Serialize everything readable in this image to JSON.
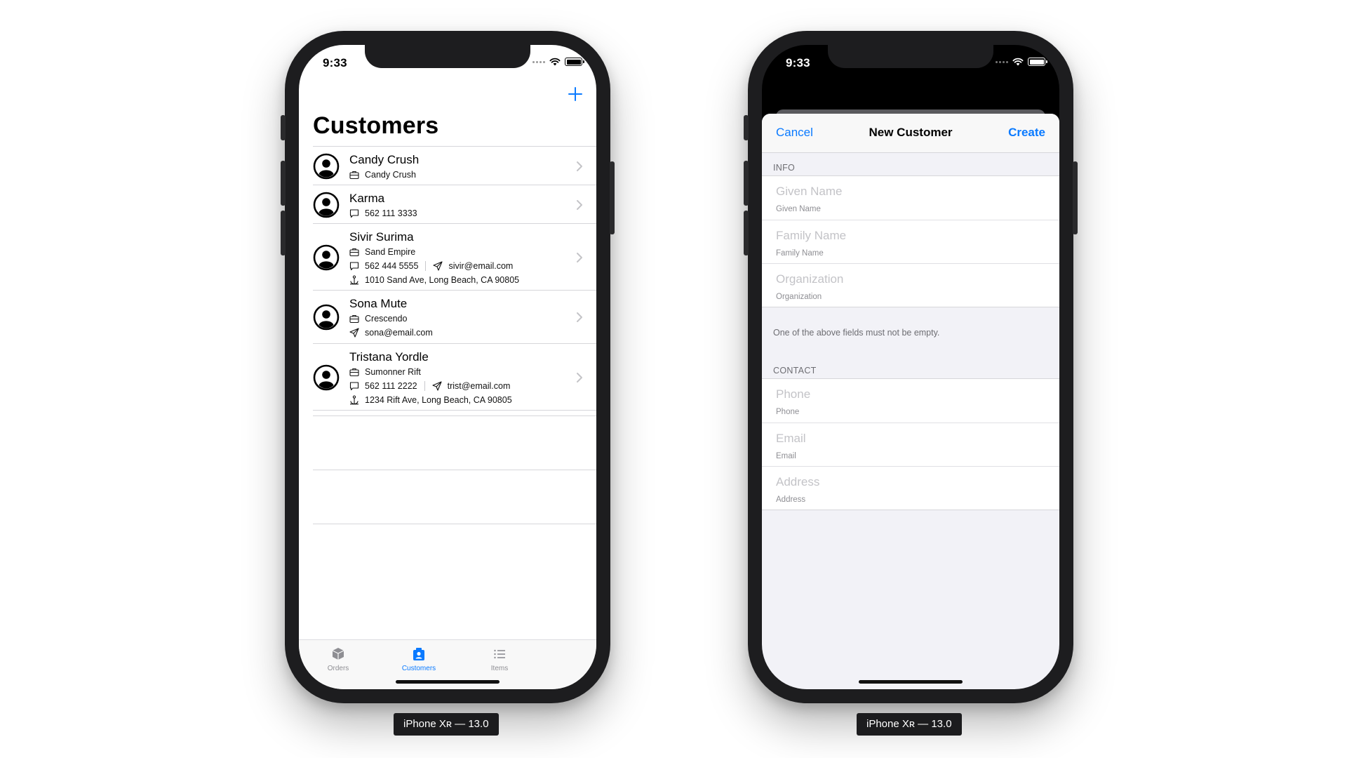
{
  "left_device": {
    "status_time": "9:33",
    "title": "Customers",
    "customers": [
      {
        "name": "Candy Crush",
        "lines": [
          [
            {
              "icon": "briefcase-icon",
              "text": "Candy Crush"
            }
          ]
        ]
      },
      {
        "name": "Karma",
        "lines": [
          [
            {
              "icon": "message-icon",
              "text": "562 111 3333"
            }
          ]
        ]
      },
      {
        "name": "Sivir Surima",
        "lines": [
          [
            {
              "icon": "briefcase-icon",
              "text": "Sand Empire"
            }
          ],
          [
            {
              "icon": "message-icon",
              "text": "562 444 5555"
            },
            {
              "icon": "send-icon",
              "text": "sivir@email.com"
            }
          ],
          [
            {
              "icon": "anchor-icon",
              "text": "1010 Sand Ave, Long Beach, CA 90805"
            }
          ]
        ]
      },
      {
        "name": "Sona Mute",
        "lines": [
          [
            {
              "icon": "briefcase-icon",
              "text": "Crescendo"
            }
          ],
          [
            {
              "icon": "send-icon",
              "text": "sona@email.com"
            }
          ]
        ]
      },
      {
        "name": "Tristana Yordle",
        "lines": [
          [
            {
              "icon": "briefcase-icon",
              "text": "Sumonner Rift"
            }
          ],
          [
            {
              "icon": "message-icon",
              "text": "562 111 2222"
            },
            {
              "icon": "send-icon",
              "text": "trist@email.com"
            }
          ],
          [
            {
              "icon": "anchor-icon",
              "text": "1234 Rift Ave, Long Beach, CA 90805"
            }
          ]
        ]
      }
    ],
    "tabs": [
      {
        "label": "Orders",
        "icon": "box-icon",
        "active": false
      },
      {
        "label": "Customers",
        "icon": "person-card-icon",
        "active": true
      },
      {
        "label": "Items",
        "icon": "list-icon",
        "active": false
      }
    ],
    "caption": "iPhone Xʀ — 13.0"
  },
  "right_device": {
    "status_time": "9:33",
    "nav": {
      "cancel": "Cancel",
      "title": "New Customer",
      "create": "Create"
    },
    "info_header": "INFO",
    "info_fields": [
      {
        "placeholder": "Given Name",
        "label": "Given Name"
      },
      {
        "placeholder": "Family Name",
        "label": "Family Name"
      },
      {
        "placeholder": "Organization",
        "label": "Organization"
      }
    ],
    "info_footer": "One of the above fields must not be empty.",
    "contact_header": "CONTACT",
    "contact_fields": [
      {
        "placeholder": "Phone",
        "label": "Phone"
      },
      {
        "placeholder": "Email",
        "label": "Email"
      },
      {
        "placeholder": "Address",
        "label": "Address"
      }
    ],
    "caption": "iPhone Xʀ — 13.0"
  },
  "colors": {
    "accent": "#0a7aff",
    "separator": "#d6d6da",
    "grouped_background": "#f2f2f7"
  }
}
